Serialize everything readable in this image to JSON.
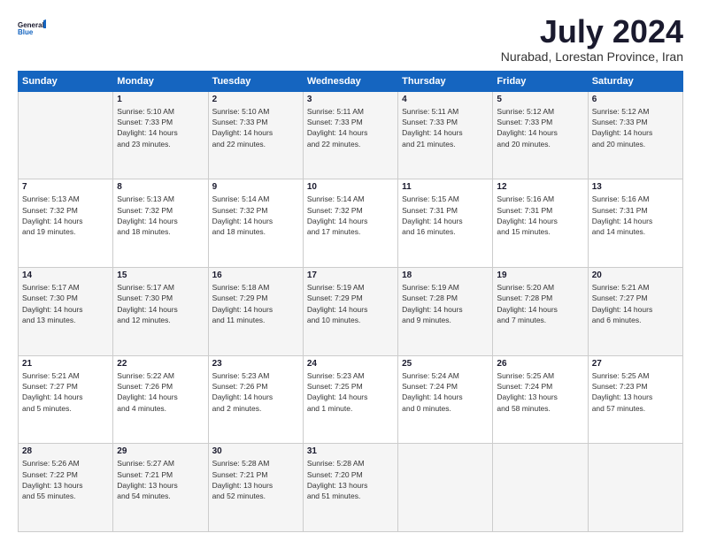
{
  "logo": {
    "line1": "General",
    "line2": "Blue"
  },
  "title": "July 2024",
  "subtitle": "Nurabad, Lorestan Province, Iran",
  "header": {
    "days": [
      "Sunday",
      "Monday",
      "Tuesday",
      "Wednesday",
      "Thursday",
      "Friday",
      "Saturday"
    ]
  },
  "weeks": [
    [
      {
        "day": "",
        "info": ""
      },
      {
        "day": "1",
        "info": "Sunrise: 5:10 AM\nSunset: 7:33 PM\nDaylight: 14 hours\nand 23 minutes."
      },
      {
        "day": "2",
        "info": "Sunrise: 5:10 AM\nSunset: 7:33 PM\nDaylight: 14 hours\nand 22 minutes."
      },
      {
        "day": "3",
        "info": "Sunrise: 5:11 AM\nSunset: 7:33 PM\nDaylight: 14 hours\nand 22 minutes."
      },
      {
        "day": "4",
        "info": "Sunrise: 5:11 AM\nSunset: 7:33 PM\nDaylight: 14 hours\nand 21 minutes."
      },
      {
        "day": "5",
        "info": "Sunrise: 5:12 AM\nSunset: 7:33 PM\nDaylight: 14 hours\nand 20 minutes."
      },
      {
        "day": "6",
        "info": "Sunrise: 5:12 AM\nSunset: 7:33 PM\nDaylight: 14 hours\nand 20 minutes."
      }
    ],
    [
      {
        "day": "7",
        "info": "Sunrise: 5:13 AM\nSunset: 7:32 PM\nDaylight: 14 hours\nand 19 minutes."
      },
      {
        "day": "8",
        "info": "Sunrise: 5:13 AM\nSunset: 7:32 PM\nDaylight: 14 hours\nand 18 minutes."
      },
      {
        "day": "9",
        "info": "Sunrise: 5:14 AM\nSunset: 7:32 PM\nDaylight: 14 hours\nand 18 minutes."
      },
      {
        "day": "10",
        "info": "Sunrise: 5:14 AM\nSunset: 7:32 PM\nDaylight: 14 hours\nand 17 minutes."
      },
      {
        "day": "11",
        "info": "Sunrise: 5:15 AM\nSunset: 7:31 PM\nDaylight: 14 hours\nand 16 minutes."
      },
      {
        "day": "12",
        "info": "Sunrise: 5:16 AM\nSunset: 7:31 PM\nDaylight: 14 hours\nand 15 minutes."
      },
      {
        "day": "13",
        "info": "Sunrise: 5:16 AM\nSunset: 7:31 PM\nDaylight: 14 hours\nand 14 minutes."
      }
    ],
    [
      {
        "day": "14",
        "info": "Sunrise: 5:17 AM\nSunset: 7:30 PM\nDaylight: 14 hours\nand 13 minutes."
      },
      {
        "day": "15",
        "info": "Sunrise: 5:17 AM\nSunset: 7:30 PM\nDaylight: 14 hours\nand 12 minutes."
      },
      {
        "day": "16",
        "info": "Sunrise: 5:18 AM\nSunset: 7:29 PM\nDaylight: 14 hours\nand 11 minutes."
      },
      {
        "day": "17",
        "info": "Sunrise: 5:19 AM\nSunset: 7:29 PM\nDaylight: 14 hours\nand 10 minutes."
      },
      {
        "day": "18",
        "info": "Sunrise: 5:19 AM\nSunset: 7:28 PM\nDaylight: 14 hours\nand 9 minutes."
      },
      {
        "day": "19",
        "info": "Sunrise: 5:20 AM\nSunset: 7:28 PM\nDaylight: 14 hours\nand 7 minutes."
      },
      {
        "day": "20",
        "info": "Sunrise: 5:21 AM\nSunset: 7:27 PM\nDaylight: 14 hours\nand 6 minutes."
      }
    ],
    [
      {
        "day": "21",
        "info": "Sunrise: 5:21 AM\nSunset: 7:27 PM\nDaylight: 14 hours\nand 5 minutes."
      },
      {
        "day": "22",
        "info": "Sunrise: 5:22 AM\nSunset: 7:26 PM\nDaylight: 14 hours\nand 4 minutes."
      },
      {
        "day": "23",
        "info": "Sunrise: 5:23 AM\nSunset: 7:26 PM\nDaylight: 14 hours\nand 2 minutes."
      },
      {
        "day": "24",
        "info": "Sunrise: 5:23 AM\nSunset: 7:25 PM\nDaylight: 14 hours\nand 1 minute."
      },
      {
        "day": "25",
        "info": "Sunrise: 5:24 AM\nSunset: 7:24 PM\nDaylight: 14 hours\nand 0 minutes."
      },
      {
        "day": "26",
        "info": "Sunrise: 5:25 AM\nSunset: 7:24 PM\nDaylight: 13 hours\nand 58 minutes."
      },
      {
        "day": "27",
        "info": "Sunrise: 5:25 AM\nSunset: 7:23 PM\nDaylight: 13 hours\nand 57 minutes."
      }
    ],
    [
      {
        "day": "28",
        "info": "Sunrise: 5:26 AM\nSunset: 7:22 PM\nDaylight: 13 hours\nand 55 minutes."
      },
      {
        "day": "29",
        "info": "Sunrise: 5:27 AM\nSunset: 7:21 PM\nDaylight: 13 hours\nand 54 minutes."
      },
      {
        "day": "30",
        "info": "Sunrise: 5:28 AM\nSunset: 7:21 PM\nDaylight: 13 hours\nand 52 minutes."
      },
      {
        "day": "31",
        "info": "Sunrise: 5:28 AM\nSunset: 7:20 PM\nDaylight: 13 hours\nand 51 minutes."
      },
      {
        "day": "",
        "info": ""
      },
      {
        "day": "",
        "info": ""
      },
      {
        "day": "",
        "info": ""
      }
    ]
  ]
}
